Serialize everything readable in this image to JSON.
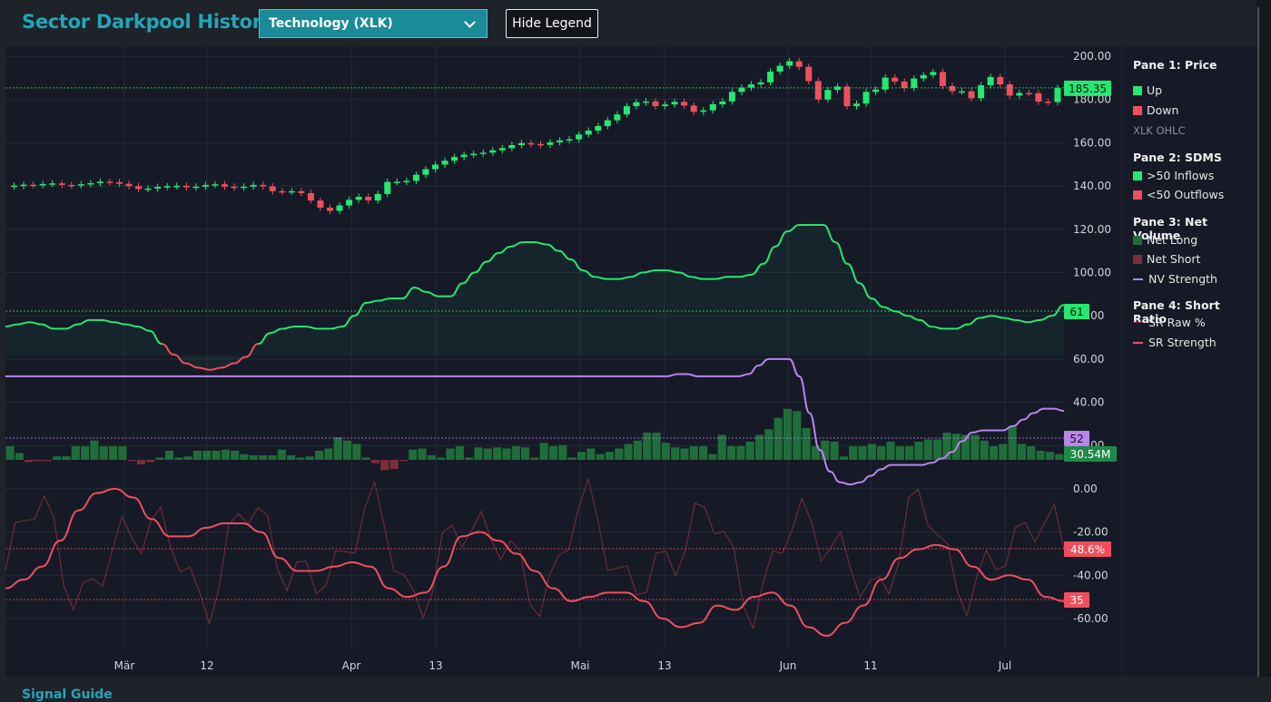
{
  "header": {
    "title": "Sector Darkpool History",
    "select_value": "Technology (XLK)",
    "legend_button": "Hide Legend"
  },
  "footer": {
    "label": "Signal Guide"
  },
  "legend": {
    "p1_title": "Pane 1: Price",
    "p1_up": "Up",
    "p1_down": "Down",
    "p1_sub": "XLK OHLC",
    "p2_title": "Pane 2: SDMS",
    "p2_in": ">50 Inflows",
    "p2_out": "<50 Outflows",
    "p3_title": "Pane 3: Net Volume",
    "p3_long": "Net Long",
    "p3_short": "Net Short",
    "p3_nv": "NV Strength",
    "p4_title": "Pane 4: Short Ratio",
    "p4_raw": "SR Raw %",
    "p4_str": "SR Strength"
  },
  "colors": {
    "up": "#26e870",
    "down": "#ef4f5c",
    "net_long": "#1f6e3a",
    "net_short": "#7c2e38",
    "nv": "#b985e8",
    "sr_raw": "#7c2e38",
    "sr": "#ef4f5c",
    "accent": "#21a6b8"
  },
  "chart_data": {
    "type": "candlestick",
    "y_ticks": [
      "200.00",
      "180.00",
      "160.00",
      "140.00",
      "120.00",
      "100.00",
      "80.00",
      "60.00",
      "40.00",
      "20.00",
      "0.00",
      "-20.00",
      "-40.00",
      "-60.00"
    ],
    "x_ticks": [
      "Mär",
      "12",
      "Apr",
      "13",
      "Mai",
      "13",
      "Jun",
      "11",
      "Jul"
    ],
    "badges": {
      "price": "185.35",
      "sdms": "61",
      "nv": "52",
      "net_vol": "30.54M",
      "sr_raw": "48.6%",
      "sr": "35"
    },
    "price_last": 185.35,
    "price_close": [
      140.2,
      140.6,
      140.4,
      140.9,
      141.2,
      140.5,
      140.3,
      140.8,
      141.3,
      142.0,
      141.8,
      141.0,
      139.9,
      138.6,
      138.8,
      139.6,
      139.9,
      140.1,
      139.4,
      139.7,
      140.5,
      140.8,
      139.7,
      139.2,
      139.7,
      140.5,
      139.8,
      137.6,
      137.4,
      137.6,
      136.7,
      133.3,
      130.0,
      128.5,
      131.0,
      133.6,
      135.0,
      133.3,
      136.3,
      141.9,
      142.0,
      142.4,
      145.2,
      147.8,
      149.9,
      151.7,
      153.4,
      154.5,
      154.9,
      155.4,
      156.5,
      157.5,
      158.9,
      159.8,
      159.4,
      159.0,
      160.2,
      161.1,
      161.6,
      163.8,
      165.6,
      167.7,
      170.4,
      173.1,
      176.9,
      178.7,
      179.1,
      176.9,
      177.7,
      178.9,
      177.2,
      174.3,
      175.0,
      177.8,
      179.1,
      183.5,
      185.5,
      187.0,
      187.9,
      192.9,
      195.6,
      197.7,
      195.1,
      188.5,
      180.0,
      184.4,
      186.0,
      176.9,
      178.1,
      183.5,
      184.6,
      190.1,
      188.3,
      185.3,
      189.7,
      191.3,
      192.7,
      186.2,
      183.8,
      183.8,
      180.6,
      186.6,
      190.4,
      187.0,
      181.8,
      183.0,
      182.9,
      179.0,
      178.8,
      185.3
    ],
    "price_open": [
      139.8,
      140.0,
      140.6,
      140.4,
      141.0,
      141.2,
      140.5,
      140.3,
      140.8,
      141.3,
      142.0,
      141.8,
      141.0,
      139.9,
      138.6,
      138.8,
      139.6,
      139.9,
      140.1,
      139.4,
      139.7,
      140.5,
      140.8,
      139.7,
      139.2,
      139.7,
      140.5,
      139.8,
      137.6,
      137.4,
      137.6,
      136.7,
      133.3,
      130.0,
      128.5,
      131.0,
      133.6,
      135.0,
      133.3,
      136.3,
      141.9,
      142.0,
      142.4,
      145.2,
      147.8,
      149.9,
      151.7,
      153.4,
      154.5,
      154.9,
      155.4,
      156.5,
      157.5,
      158.9,
      159.8,
      159.4,
      159.0,
      160.2,
      161.1,
      161.6,
      163.8,
      165.6,
      167.7,
      170.4,
      173.1,
      176.9,
      178.7,
      179.1,
      176.9,
      177.7,
      178.9,
      177.2,
      174.3,
      175.0,
      177.8,
      179.1,
      183.5,
      185.5,
      187.0,
      187.9,
      192.9,
      195.6,
      197.7,
      195.1,
      188.5,
      180.0,
      184.4,
      186.0,
      176.9,
      178.1,
      183.5,
      184.6,
      190.1,
      188.3,
      185.3,
      189.7,
      191.3,
      192.7,
      186.2,
      183.8,
      183.8,
      180.6,
      186.6,
      190.4,
      187.0,
      181.8,
      183.0,
      182.9,
      179.0,
      178.8
    ],
    "sdms": [
      75,
      76,
      77,
      76,
      74,
      74,
      76,
      78,
      78,
      77,
      76,
      75,
      73,
      67,
      62,
      58,
      56,
      55,
      56,
      58,
      61,
      67,
      72,
      74,
      75,
      75,
      74,
      74,
      75,
      80,
      86,
      87,
      88,
      88,
      93,
      91,
      89,
      89,
      95,
      100,
      105,
      109,
      112,
      114,
      114,
      113,
      110,
      106,
      101,
      98,
      97,
      97,
      98,
      100,
      101,
      101,
      100,
      98,
      97,
      97,
      98,
      98,
      99,
      104,
      112,
      119,
      122,
      122,
      122,
      114,
      104,
      95,
      88,
      84,
      82,
      80,
      78,
      75,
      74,
      74,
      76,
      79,
      80,
      79,
      78,
      77,
      78,
      80,
      85
    ],
    "nv_strength": [
      52,
      52,
      52,
      52,
      52,
      52,
      52,
      52,
      52,
      52,
      52,
      52,
      52,
      52,
      52,
      52,
      52,
      52,
      52,
      52,
      52,
      52,
      52,
      52,
      52,
      52,
      52,
      52,
      52,
      52,
      52,
      52,
      52,
      52,
      52,
      52,
      52,
      52,
      52,
      52,
      52,
      52,
      52,
      52,
      52,
      52,
      52,
      52,
      52,
      52,
      52,
      52,
      52,
      52,
      52,
      52,
      52,
      52,
      52,
      52,
      52,
      52,
      52,
      52,
      52,
      52,
      53,
      53,
      52,
      52,
      52,
      52,
      52,
      53,
      57,
      60,
      60,
      60,
      52,
      35,
      18,
      8,
      3,
      2,
      3,
      6,
      9,
      11,
      11,
      11,
      11,
      12,
      14,
      17,
      22,
      26,
      27,
      27,
      27,
      29,
      32,
      35,
      37,
      37,
      36
    ],
    "net_volume": [
      12,
      6,
      -2,
      -1,
      -1,
      3,
      3,
      12,
      12,
      17,
      12,
      12,
      12,
      -1,
      -4,
      -2,
      2,
      8,
      2,
      3,
      8,
      8,
      8,
      9,
      8,
      5,
      4,
      4,
      4,
      9,
      4,
      2,
      3,
      8,
      10,
      20,
      17,
      14,
      2,
      -3,
      -9,
      -8,
      -1,
      9,
      10,
      4,
      2,
      10,
      12,
      2,
      11,
      10,
      11,
      10,
      12,
      11,
      2,
      15,
      12,
      13,
      2,
      7,
      10,
      5,
      7,
      10,
      14,
      17,
      24,
      24,
      15,
      11,
      10,
      12,
      12,
      5,
      22,
      12,
      12,
      16,
      22,
      27,
      37,
      45,
      43,
      28,
      12,
      17,
      16,
      3,
      12,
      12,
      14,
      12,
      16,
      12,
      12,
      16,
      18,
      18,
      24,
      23,
      22,
      22,
      17,
      12,
      14,
      30,
      14,
      12,
      8,
      7,
      5
    ]
  }
}
